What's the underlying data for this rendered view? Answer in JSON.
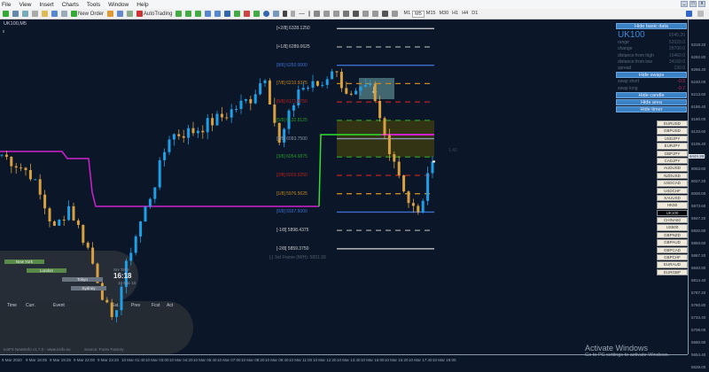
{
  "menu": [
    "File",
    "View",
    "Insert",
    "Charts",
    "Tools",
    "Window",
    "Help"
  ],
  "toolbar": {
    "new_order": "New Order",
    "autotrading": "AutoTrading",
    "timeframes": [
      "M1",
      "M5",
      "M15",
      "M30",
      "H1",
      "H4",
      "D1"
    ],
    "selected_tf": "M5"
  },
  "chart": {
    "title": "UK100,M5",
    "current_price": "6045.20",
    "side_label": "1.40"
  },
  "price_axis": [
    "6346.40",
    "6319.20",
    "6292.80",
    "6266.40",
    "6240.00",
    "6213.60",
    "6186.40",
    "6160.00",
    "6133.60",
    "6106.40",
    "6080.00",
    "6053.60",
    "6027.20",
    "6000.00",
    "5973.60",
    "5947.20",
    "5920.80",
    "5893.60",
    "5867.20",
    "5840.80",
    "5814.40",
    "5787.20",
    "5760.80",
    "5734.40",
    "5708.00",
    "5680.80",
    "5654.40",
    "5628.00"
  ],
  "time_axis": [
    "9 Mar 2020",
    "9 Mar 18:05",
    "9 Mar 19:25",
    "9 Mar 22:00",
    "9 Mar 23:20",
    "10 Mar 01:40",
    "10 Mar 03:00",
    "10 Mar 04:20",
    "10 Mar 05:40",
    "10 Mar 07:00",
    "10 Mar 08:20",
    "10 Mar 09:40",
    "10 Mar 11:00",
    "10 Mar 12:20",
    "10 Mar 13:40",
    "10 Mar 15:00",
    "10 Mar 16:20",
    "10 Mar 17:40",
    "10 Mar 19:00"
  ],
  "murrey": [
    {
      "label": "[+2/8]  6328.1250",
      "price": 6328.125,
      "color": "#d8d8d8",
      "dash": false
    },
    {
      "label": "[+1/8]  6289.0625",
      "price": 6289.0625,
      "color": "#a0a0a0",
      "dash": true
    },
    {
      "label": "[8/8]  6250.0000",
      "price": 6250,
      "color": "#3d6fd0",
      "dash": false
    },
    {
      "label": "[7/8]  6210.9375",
      "price": 6210.9375,
      "color": "#c88a20",
      "dash": true
    },
    {
      "label": "[6/8]  6171.8750",
      "price": 6171.875,
      "color": "#c02020",
      "dash": true
    },
    {
      "label": "[5/8]  6132.8125",
      "price": 6132.8125,
      "color": "#2a9a2a",
      "dash": true
    },
    {
      "label": "[4/8]  6093.7500",
      "price": 6093.75,
      "color": "#8a9ab0",
      "dash": false
    },
    {
      "label": "[3/8]  6054.6875",
      "price": 6054.6875,
      "color": "#2a9a2a",
      "dash": true
    },
    {
      "label": "[2/8]  6015.6250",
      "price": 6015.625,
      "color": "#c02020",
      "dash": true
    },
    {
      "label": "[1/8]  5976.5625",
      "price": 5976.5625,
      "color": "#c88a20",
      "dash": true
    },
    {
      "label": "[0/8]  5937.5000",
      "price": 5937.5,
      "color": "#3d6fd0",
      "dash": false
    },
    {
      "label": "[-1/8]  5898.4375",
      "price": 5898.4375,
      "color": "#a0a0a0",
      "dash": true
    },
    {
      "label": "[-2/8]  5859.3750",
      "price": 5859.375,
      "color": "#d8d8d8",
      "dash": false
    }
  ],
  "frame_label": "[-] 3rd Frame (M/H): 5831.33",
  "info_panel": {
    "hide_basic": "Hide basic data",
    "symbol": "UK100",
    "price": "6045.20",
    "rows": [
      {
        "k": "range",
        "v": "52020.0"
      },
      {
        "k": "change",
        "v": "28700.0"
      },
      {
        "k": "distance from high",
        "v": "16460.0"
      },
      {
        "k": "distance from low",
        "v": "34160.0"
      },
      {
        "k": "spread",
        "v": "130.0"
      }
    ],
    "hide_swaps": "Hide swaps",
    "swaps": [
      {
        "k": "swap short",
        "v": "-0.5"
      },
      {
        "k": "swap long",
        "v": "-0.7"
      }
    ],
    "hide_candle": "Hide candle",
    "hide_area": "Hide area",
    "hide_timer": "Hide timer"
  },
  "symbols": [
    "EURUSD",
    "GBPUSD",
    "USDJPY",
    "EURJPY",
    "GBPJPY",
    "CADJPY",
    "AUDUSD",
    "NZDUSD",
    "USDCAD",
    "USDCHF",
    "XAUUSD",
    "HK50",
    "UK100",
    "CHINA50",
    "US500",
    "GBPNZD",
    "GBPAUD",
    "GBPCAD",
    "GBPCHF",
    "EURAUD",
    "EURGBP"
  ],
  "selected_symbol": "UK100",
  "sessions": [
    {
      "name": "New York",
      "color": "#5a8a4a"
    },
    {
      "name": "London",
      "color": "#5a8a4a"
    },
    {
      "name": "Tokyo",
      "color": "#6a7480"
    },
    {
      "name": "Sydney",
      "color": "#6a7480"
    }
  ],
  "clock": {
    "label": "Srv Time",
    "time": "16:18",
    "date": "10 Mar 10"
  },
  "news_headers": [
    "Time",
    "Curr.",
    "Event",
    "Est.",
    "Prev",
    "Fcst",
    "Act"
  ],
  "news_footer": {
    "left": "IceFX NewsInfo v1.7.0 - www.icefx.eu",
    "right": "Source: Forex Factory"
  },
  "activate": {
    "title": "Activate Windows",
    "sub": "Go to PC settings to activate Windows."
  },
  "chart_data": {
    "type": "candlestick",
    "keypoints": [
      [
        0,
        6060
      ],
      [
        6,
        6020
      ],
      [
        11,
        5900
      ],
      [
        14,
        5950
      ],
      [
        18,
        5860
      ],
      [
        23,
        5700
      ],
      [
        27,
        5860
      ],
      [
        32,
        6000
      ],
      [
        35,
        6100
      ],
      [
        40,
        6110
      ],
      [
        46,
        6140
      ],
      [
        52,
        6180
      ],
      [
        55,
        6230
      ],
      [
        58,
        6080
      ],
      [
        62,
        6200
      ],
      [
        67,
        6210
      ],
      [
        69,
        6245
      ],
      [
        73,
        6180
      ],
      [
        77,
        6200
      ],
      [
        80,
        6100
      ],
      [
        82,
        6050
      ],
      [
        85,
        5960
      ],
      [
        87,
        5930
      ],
      [
        90,
        6045
      ]
    ]
  }
}
